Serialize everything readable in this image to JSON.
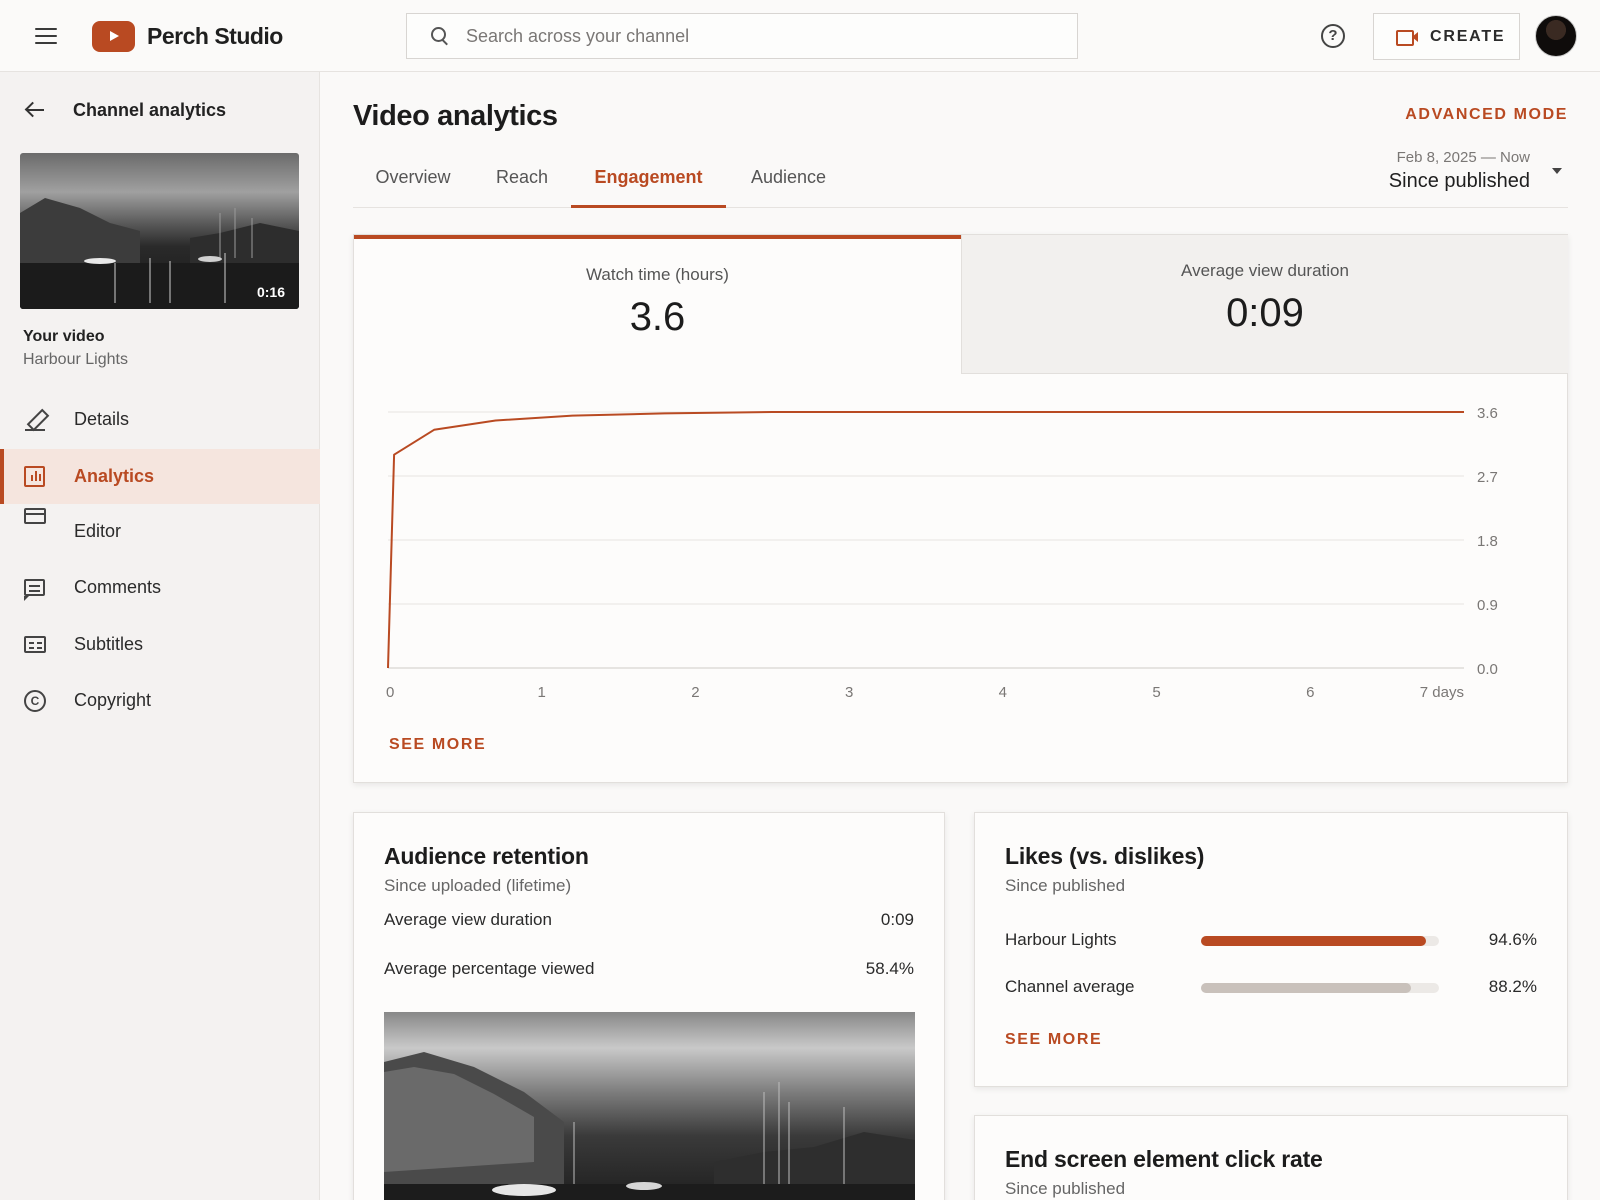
{
  "header": {
    "logo_text": "Perch Studio",
    "search_placeholder": "Search across your channel",
    "create_label": "CREATE"
  },
  "sidebar": {
    "back_label": "Channel analytics",
    "thumb_duration": "0:16",
    "your_video_label": "Your video",
    "video_name": "Harbour Lights",
    "items": [
      {
        "label": "Details",
        "icon": "pencil-icon"
      },
      {
        "label": "Analytics",
        "icon": "analytics-icon",
        "active": true
      },
      {
        "label": "Editor",
        "icon": "film-icon"
      },
      {
        "label": "Comments",
        "icon": "comment-icon"
      },
      {
        "label": "Subtitles",
        "icon": "subtitles-icon"
      },
      {
        "label": "Copyright",
        "icon": "copyright-icon"
      }
    ]
  },
  "main": {
    "title": "Video analytics",
    "advanced_mode": "ADVANCED MODE",
    "tabs": [
      "Overview",
      "Reach",
      "Engagement",
      "Audience"
    ],
    "active_tab": "Engagement",
    "date_range": "Feb 8, 2025 — Now",
    "date_label": "Since published",
    "metrics": [
      {
        "label": "Watch time (hours)",
        "value": "3.6"
      },
      {
        "label": "Average view duration",
        "value": "0:09"
      }
    ],
    "see_more": "SEE MORE"
  },
  "retention": {
    "title": "Audience retention",
    "subtitle": "Since uploaded (lifetime)",
    "rows": [
      {
        "label": "Average view duration",
        "value": "0:09"
      },
      {
        "label": "Average percentage viewed",
        "value": "58.4%"
      }
    ]
  },
  "likes": {
    "title": "Likes (vs. dislikes)",
    "subtitle": "Since published",
    "rows": [
      {
        "label": "Harbour Lights",
        "value": "94.6%",
        "fraction": 0.946,
        "color": "#b94a22"
      },
      {
        "label": "Channel average",
        "value": "88.2%",
        "fraction": 0.882,
        "color": "#c9c1bb"
      }
    ],
    "see_more": "SEE MORE"
  },
  "end_screen": {
    "title": "End screen element click rate",
    "subtitle": "Since published"
  },
  "colors": {
    "accent": "#b94a22",
    "line": "#b94a22",
    "grid": "#e8e5e2"
  },
  "chart_data": {
    "type": "line",
    "title": "Watch time (hours)",
    "x": [
      0,
      0.04,
      0.3,
      0.7,
      1.2,
      1.8,
      2.5,
      3.5,
      7
    ],
    "values": [
      0.0,
      3.0,
      3.35,
      3.48,
      3.55,
      3.58,
      3.6,
      3.6,
      3.6
    ],
    "x_ticks": [
      "0",
      "1",
      "2",
      "3",
      "4",
      "5",
      "6",
      "7 days"
    ],
    "y_ticks": [
      "0.0",
      "0.9",
      "1.8",
      "2.7",
      "3.6"
    ],
    "xlim": [
      0,
      7
    ],
    "ylim": [
      0,
      3.6
    ],
    "grid": true,
    "y_axis_side": "right"
  }
}
